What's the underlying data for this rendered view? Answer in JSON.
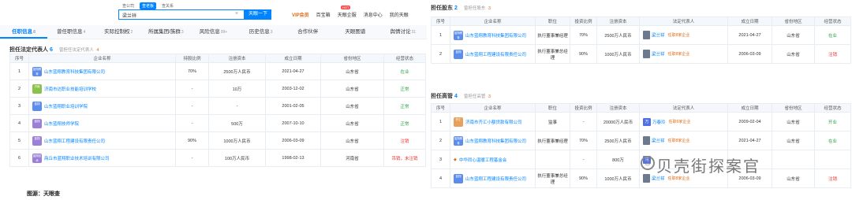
{
  "search": {
    "tabs": [
      "查公司",
      "查老板",
      "查关系"
    ],
    "active_tab": "查老板",
    "value": "梁兰祥",
    "button": "天眼一下"
  },
  "topnav": {
    "vip": "VIP会员",
    "items": [
      "百宝箱",
      "天眼企服",
      "消息中心",
      "我的天眼"
    ],
    "hot": "HOT"
  },
  "main_tabs": [
    {
      "label": "任职信息",
      "count": "8"
    },
    {
      "label": "曾任职信息",
      "count": "4"
    },
    {
      "label": "实际控制权",
      "count": "2"
    },
    {
      "label": "所属集团/族群",
      "count": "3"
    },
    {
      "label": "风险信息",
      "count": "99+"
    },
    {
      "label": "历史信息",
      "count": "3"
    },
    {
      "label": "合作伙伴",
      "count": ""
    },
    {
      "label": "天眼图谱",
      "count": ""
    },
    {
      "label": "舆情讨论",
      "count": "31"
    }
  ],
  "legal_rep": {
    "title": "担任法定代表人",
    "count": "6",
    "sub_label": "曾担任法定代表人",
    "sub_count": "4",
    "headers": [
      "序号",
      "企业名称",
      "持股比例",
      "注册资本",
      "成立日期",
      "省份地区",
      "经营状态"
    ],
    "rows": [
      {
        "no": "1",
        "logo": "蓝翔教育",
        "logo_color": "#5b8def",
        "name": "山东蓝翔教育科技集团有限公司",
        "ratio": "70%",
        "capital": "2500万人民币",
        "date": "2021-04-27",
        "region": "山东省",
        "status": "在业",
        "status_color": "green"
      },
      {
        "no": "2",
        "logo": "济南",
        "logo_color": "#8bc34a",
        "name": "济南市达职业技能培训学校",
        "ratio": "-",
        "capital": "10万",
        "date": "2003-12-02",
        "region": "山东省",
        "status": "正常",
        "status_color": "green"
      },
      {
        "no": "3",
        "logo": "蓝翔",
        "logo_color": "#5b8def",
        "name": "山东蓝翔职业培训学院",
        "ratio": "-",
        "capital": "-",
        "date": "2001-02-05",
        "region": "山东省",
        "status": "正常",
        "status_color": "green"
      },
      {
        "no": "4",
        "logo": "蓝翔",
        "logo_color": "#9c7fd8",
        "name": "山东蓝翔技师学院",
        "ratio": "-",
        "capital": "500万",
        "date": "2007-10-10",
        "region": "山东省",
        "status": "正常",
        "status_color": "green"
      },
      {
        "no": "5",
        "logo": "蓝翔",
        "logo_color": "#9c7fd8",
        "name": "山东蓝翔工程建设有限责任公司",
        "ratio": "90%",
        "capital": "1000万人民币",
        "date": "2006-03-09",
        "region": "山东省",
        "status": "注销",
        "status_color": "red"
      },
      {
        "no": "6",
        "logo": "蓝翔技术",
        "logo_color": "#9c7fd8",
        "name": "商丘市蓝翔职业技术培训有限公司",
        "ratio": "-",
        "capital": "100万人民币",
        "date": "1998-02-13",
        "region": "河南省",
        "status": "吊销，未注销",
        "status_color": "red"
      }
    ]
  },
  "shareholder": {
    "title": "担任股东",
    "count": "2",
    "sub_label": "曾担任股东",
    "sub_count": "3",
    "headers": [
      "序号",
      "企业名称",
      "职位",
      "投资比例",
      "注册资本",
      "法定代表人",
      "成立日期",
      "省份地区",
      "经营状态"
    ],
    "rows": [
      {
        "no": "1",
        "logo": "蓝翔教育",
        "logo_color": "#5b8def",
        "name": "山东蓝翔教育科技集团有限公司",
        "position": "执行董事兼经理",
        "ratio": "70%",
        "capital": "2500万人民币",
        "rep": "梁兰祥",
        "rep_tag": "任职8家企业",
        "date": "2021-04-27",
        "region": "山东省",
        "status": "在业",
        "status_color": "green"
      },
      {
        "no": "2",
        "logo": "蓝翔",
        "logo_color": "#5b8def",
        "name": "山东蓝翔工程建设有限责任公司",
        "position": "执行董事兼总经理",
        "ratio": "90%",
        "capital": "1000万人民币",
        "rep": "梁兰祥",
        "rep_tag": "任职8家企业",
        "date": "2006-03-09",
        "region": "山东省",
        "status": "注销",
        "status_color": "red"
      }
    ]
  },
  "executive": {
    "title": "担任高管",
    "count": "4",
    "sub_label": "曾担任高管",
    "sub_count": "3",
    "headers": [
      "序号",
      "企业名称",
      "职位",
      "投资比例",
      "注册资本",
      "法定代表人",
      "成立日期",
      "省份地区",
      "经营状态"
    ],
    "rows": [
      {
        "no": "1",
        "logo": "齐汇",
        "logo_color": "#e8a15c",
        "name": "济南市齐汇小额贷款有限公司",
        "position": "监事",
        "ratio": "-",
        "capital": "20000万人民币",
        "rep": "万春玲",
        "rep_tag": "任职6家企业",
        "rep_avatar": "万",
        "date": "2009-02-04",
        "region": "山东省",
        "status": "开业",
        "status_color": "green"
      },
      {
        "no": "2",
        "logo": "蓝翔教育",
        "logo_color": "#5b8def",
        "name": "山东蓝翔教育科技集团有限公司",
        "position": "执行董事兼经理",
        "ratio": "70%",
        "capital": "2500万人民币",
        "rep": "梁兰祥",
        "rep_tag": "任职8家企业",
        "rep_avatar": "",
        "date": "2021-04-27",
        "region": "山东省",
        "status": "在业",
        "status_color": "green"
      },
      {
        "no": "3",
        "logo": "",
        "logo_color": "",
        "name": "中华同心温暖工程基金会",
        "position": "",
        "ratio": "-",
        "capital": "800万",
        "rep": "马",
        "rep_tag": "",
        "rep_avatar": "马",
        "date": "",
        "region": "",
        "status": "",
        "status_color": "green"
      },
      {
        "no": "4",
        "logo": "蓝翔",
        "logo_color": "#5b8def",
        "name": "山东蓝翔工程建设有限责任公司",
        "position": "执行董事兼总经理",
        "ratio": "90%",
        "capital": "1000万人民币",
        "rep": "梁兰祥",
        "rep_tag": "任职8家企业",
        "rep_avatar": "",
        "date": "2006-03-09",
        "region": "山东省",
        "status": "注销",
        "status_color": "red"
      }
    ]
  },
  "source_label": "图源：天眼查",
  "watermark": "贝壳街探案官"
}
